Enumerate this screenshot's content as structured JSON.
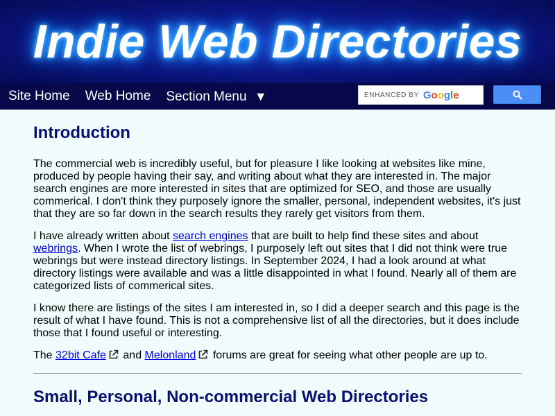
{
  "header": {
    "title": "Indie Web Directories"
  },
  "nav": {
    "items": [
      "Site Home",
      "Web Home",
      "Section Menu"
    ],
    "menu_arrow": "▼"
  },
  "search": {
    "enhanced_label": "ENHANCED BY",
    "provider": "Google",
    "button_icon": "search-icon"
  },
  "main": {
    "intro_heading": "Introduction",
    "p1": "The commercial web is incredibly useful, but for pleasure I like looking at websites like mine, produced by people having their say, and writing about what they are interested in. The major search engines are more interested in sites that are optimized for SEO, and those are usually commerical. I don't think they purposely ignore the smaller, personal, independent websites, it's just that they are so far down in the search results they rarely get visitors from them.",
    "p2": {
      "t1": "I have already written about ",
      "link1": "search engines",
      "t2": " that are built to help find these sites and about ",
      "link2": "webrings",
      "t3": ". When I wrote the list of webrings, I purposely left out sites that I did not think were true webrings but were instead directory listings. In September 2024, I had a look around at what directory listings were available and was a little disappointed in what I found. Nearly all of them are categorized lists of commerical sites."
    },
    "p3": "I know there are listings of the sites I am interested in, so I did a deeper search and this page is the result of what I have found. This is not a comprehensive list of all the directories, but it does include those that I found useful or interesting.",
    "p4": {
      "t1": "The ",
      "link1": "32bit Cafe",
      "t2": " and ",
      "link2": "Melonland",
      "t3": " forums are great for seeing what other people are up to."
    },
    "second_heading": "Small, Personal, Non-commercial Web Directories"
  },
  "colors": {
    "header_bg": "#0c1580",
    "nav_bg": "#06084a",
    "heading": "#0a1070",
    "page_bg": "#f0fbfb",
    "link": "#0000ee",
    "search_button": "#4b8ef6"
  }
}
